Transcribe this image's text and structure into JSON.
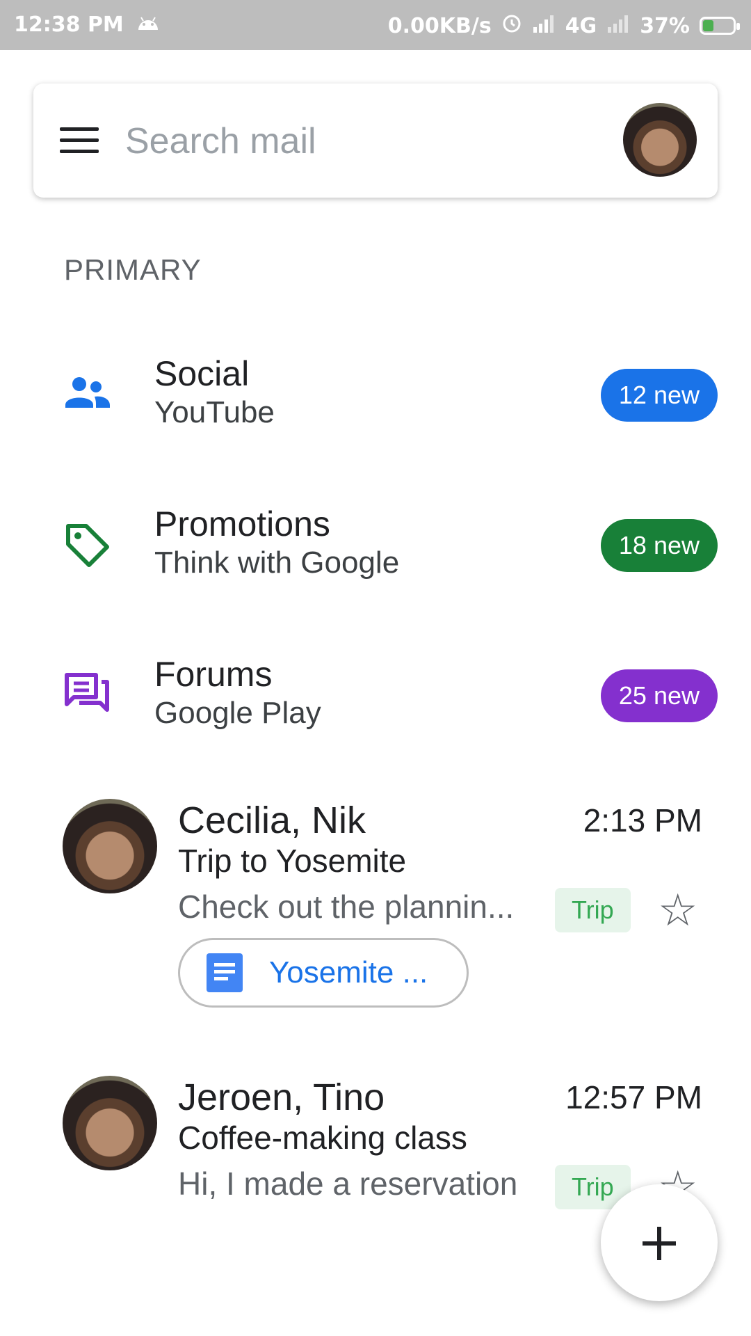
{
  "status_bar": {
    "time": "12:38 PM",
    "speed": "0.00KB/s",
    "network": "4G",
    "battery": "37%",
    "icons": [
      "android-icon",
      "alarm-icon",
      "signal-icon",
      "signal-icon",
      "battery-icon"
    ]
  },
  "search": {
    "placeholder": "Search mail"
  },
  "section": {
    "label": "PRIMARY"
  },
  "categories": [
    {
      "title": "Social",
      "sub": "YouTube",
      "badge": "12 new",
      "color": "#1a73e8",
      "icon": "people-icon"
    },
    {
      "title": "Promotions",
      "sub": "Think with Google",
      "badge": "18 new",
      "color": "#188038",
      "icon": "tag-icon"
    },
    {
      "title": "Forums",
      "sub": "Google Play",
      "badge": "25 new",
      "color": "#8430ce",
      "icon": "forum-icon"
    }
  ],
  "emails": [
    {
      "from": "Cecilia, Nik",
      "time": "2:13 PM",
      "subject": "Trip to Yosemite",
      "preview": "Check out the plannin...",
      "tag": "Trip",
      "attachment": "Yosemite ..."
    },
    {
      "from": "Jeroen, Tino",
      "time": "12:57 PM",
      "subject": "Coffee-making class",
      "preview": "Hi, I made a reservation",
      "tag": "Trip"
    }
  ]
}
